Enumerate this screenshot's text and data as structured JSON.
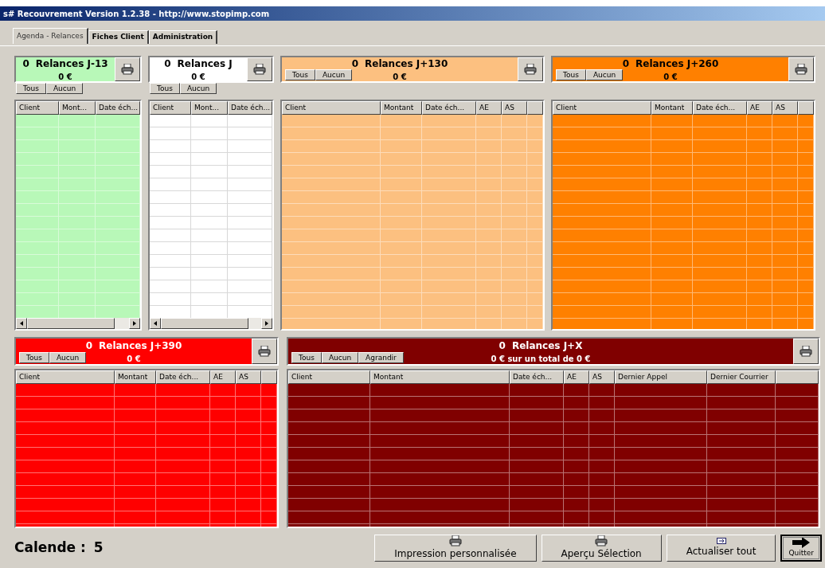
{
  "window": {
    "title": "s# Recouvrement Version 1.2.38 - http://www.stopimp.com"
  },
  "tabs": [
    {
      "label": "Agenda - Relances",
      "selected": true
    },
    {
      "label": "Fiches Client",
      "selected": false
    },
    {
      "label": "Administration",
      "selected": false
    }
  ],
  "top_panels": [
    {
      "kind": "narrow",
      "count": "0",
      "title": "Relances J-13",
      "amount": "0 €",
      "color": "#b8f8b8",
      "buttons": [
        "Tous",
        "Aucun"
      ],
      "columns": [
        "Client",
        "Mont...",
        "Date éch..."
      ]
    },
    {
      "kind": "narrow",
      "count": "0",
      "title": "Relances J",
      "amount": "0 €",
      "color": "#ffffff",
      "buttons": [
        "Tous",
        "Aucun"
      ],
      "columns": [
        "Client",
        "Mont...",
        "Date éch..."
      ]
    },
    {
      "kind": "wide",
      "count": "0",
      "title": "Relances J+130",
      "amount": "0 €",
      "color": "#fcc080",
      "buttons": [
        "Tous",
        "Aucun"
      ],
      "columns": [
        "Client",
        "Montant",
        "Date éch...",
        "AE",
        "AS"
      ]
    },
    {
      "kind": "wide",
      "count": "0",
      "title": "Relances J+260",
      "amount": "0 €",
      "color": "#ff8000",
      "buttons": [
        "Tous",
        "Aucun"
      ],
      "columns": [
        "Client",
        "Montant",
        "Date éch...",
        "AE",
        "AS"
      ]
    }
  ],
  "bottom_panels": [
    {
      "kind": "wide",
      "count": "0",
      "title": "Relances J+390",
      "amount": "0 €",
      "color": "#ff0000",
      "buttons": [
        "Tous",
        "Aucun"
      ],
      "columns": [
        "Client",
        "Montant",
        "Date éch...",
        "AE",
        "AS"
      ]
    },
    {
      "kind": "wide",
      "count": "0",
      "title": "Relances J+X",
      "amount": "0 € sur un total de  0 €",
      "color": "#800000",
      "buttons": [
        "Tous",
        "Aucun",
        "Agrandir"
      ],
      "columns": [
        "Client",
        "Montant",
        "Date éch...",
        "AE",
        "AS",
        "Dernier Appel",
        "Dernier Courrier"
      ]
    }
  ],
  "status": {
    "label": "Calende :",
    "value": "5"
  },
  "footer_buttons": [
    {
      "kind": "print",
      "label": "Impression personnalisée"
    },
    {
      "kind": "print",
      "label": "Aperçu Sélection"
    },
    {
      "kind": "refresh",
      "label": "Actualiser tout"
    },
    {
      "kind": "exit",
      "label": "Quitter"
    }
  ]
}
